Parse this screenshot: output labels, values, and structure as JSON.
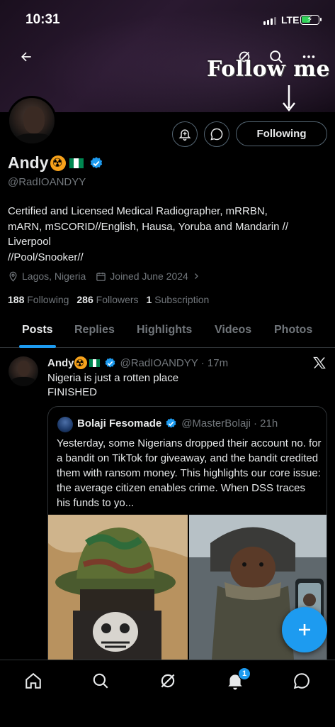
{
  "status_bar": {
    "time": "10:31",
    "network": "LTE"
  },
  "overlay": {
    "caption": "Follow me"
  },
  "profile": {
    "display_name": "Andy",
    "handle": "@RadIOANDYY",
    "bio": [
      "Certified and Licensed Medical Radiographer, mRRBN,",
      "mARN, mSCORID//English, Hausa, Yoruba and Mandarin //",
      "Liverpool",
      "//Pool/Snooker//"
    ],
    "location": "Lagos, Nigeria",
    "joined": "Joined June 2024",
    "following_count": "188",
    "following_label": "Following",
    "followers_count": "286",
    "followers_label": "Followers",
    "subscription_count": "1",
    "subscription_label": "Subscription",
    "follow_button_label": "Following"
  },
  "tabs": [
    "Posts",
    "Replies",
    "Highlights",
    "Videos",
    "Photos"
  ],
  "tweet": {
    "author_name": "Andy",
    "author_handle": "@RadIOANDYY",
    "time": "· 17m",
    "text_line1": "Nigeria is just a rotten place",
    "text_line2": "FINISHED",
    "quote": {
      "author_name": "Bolaji Fesomade",
      "author_handle": "@MasterBolaji",
      "time": "· 21h",
      "text": "Yesterday, some Nigerians dropped their account no. for a bandit on TikTok for giveaway, and the bandit credited them with ransom money. This highlights our core issue: the average citizen enables crime. When DSS traces his funds to yo..."
    }
  },
  "bottom_nav": {
    "notifications_badge": "1"
  },
  "colors": {
    "accent": "#1d9bf0",
    "background": "#000000",
    "muted": "#71767b",
    "text": "#e7e9ea"
  }
}
